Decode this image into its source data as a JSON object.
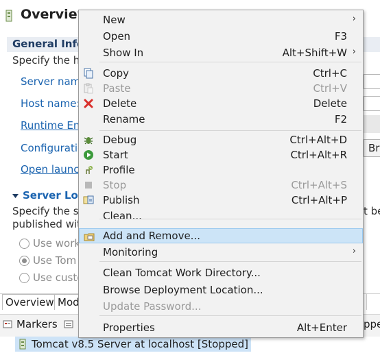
{
  "editor": {
    "title": "Overview",
    "general_section": "General Infor",
    "general_desc": "Specify the h",
    "fields": [
      "Server name",
      "Host name:",
      "Runtime Env",
      "Configuration",
      "Open launch"
    ],
    "dropdown_value": "Br",
    "location_section": "Server Loca",
    "location_desc_1": "Specify the se",
    "location_desc_2": "published wit",
    "location_desc_right": "t be",
    "radio_options": [
      "Use work",
      "Use Tom",
      "Use custo"
    ],
    "tabs": [
      "Overview",
      "Mod"
    ]
  },
  "bottom_panel": {
    "markers_label": "Markers",
    "right_fragment": "ppet",
    "server_entry": "Tomcat v8.5 Server at localhost  [Stopped]"
  },
  "menu": {
    "items": [
      {
        "label": "New",
        "accel": "",
        "submenu": true,
        "disabled": false,
        "icon": ""
      },
      {
        "label": "Open",
        "accel": "F3",
        "submenu": false,
        "disabled": false,
        "icon": ""
      },
      {
        "label": "Show In",
        "accel": "Alt+Shift+W",
        "submenu": true,
        "disabled": false,
        "icon": ""
      },
      {
        "label": "Copy",
        "accel": "Ctrl+C",
        "submenu": false,
        "disabled": false,
        "icon": "copy-icon"
      },
      {
        "label": "Paste",
        "accel": "Ctrl+V",
        "submenu": false,
        "disabled": true,
        "icon": "paste-icon"
      },
      {
        "label": "Delete",
        "accel": "Delete",
        "submenu": false,
        "disabled": false,
        "icon": "delete-icon"
      },
      {
        "label": "Rename",
        "accel": "F2",
        "submenu": false,
        "disabled": false,
        "icon": ""
      },
      {
        "label": "Debug",
        "accel": "Ctrl+Alt+D",
        "submenu": false,
        "disabled": false,
        "icon": "debug-icon"
      },
      {
        "label": "Start",
        "accel": "Ctrl+Alt+R",
        "submenu": false,
        "disabled": false,
        "icon": "start-icon"
      },
      {
        "label": "Profile",
        "accel": "",
        "submenu": false,
        "disabled": false,
        "icon": "profile-icon"
      },
      {
        "label": "Stop",
        "accel": "Ctrl+Alt+S",
        "submenu": false,
        "disabled": true,
        "icon": "stop-icon"
      },
      {
        "label": "Publish",
        "accel": "Ctrl+Alt+P",
        "submenu": false,
        "disabled": false,
        "icon": "publish-icon"
      },
      {
        "label": "Clean...",
        "accel": "",
        "submenu": false,
        "disabled": false,
        "icon": ""
      },
      {
        "label": "Add and Remove...",
        "accel": "",
        "submenu": false,
        "disabled": false,
        "icon": "add-remove-icon",
        "highlighted": true
      },
      {
        "label": "Monitoring",
        "accel": "",
        "submenu": true,
        "disabled": false,
        "icon": ""
      },
      {
        "label": "Clean Tomcat Work Directory...",
        "accel": "",
        "submenu": false,
        "disabled": false,
        "icon": ""
      },
      {
        "label": "Browse Deployment Location...",
        "accel": "",
        "submenu": false,
        "disabled": false,
        "icon": ""
      },
      {
        "label": "Update Password...",
        "accel": "",
        "submenu": false,
        "disabled": true,
        "icon": ""
      },
      {
        "label": "Properties",
        "accel": "Alt+Enter",
        "submenu": false,
        "disabled": false,
        "icon": ""
      }
    ],
    "submenu_arrow": "›"
  },
  "colors": {
    "highlight": "#cce4f7",
    "link": "#1b64b0",
    "disabled": "#9a9a9a",
    "delete_red": "#d9302c"
  }
}
